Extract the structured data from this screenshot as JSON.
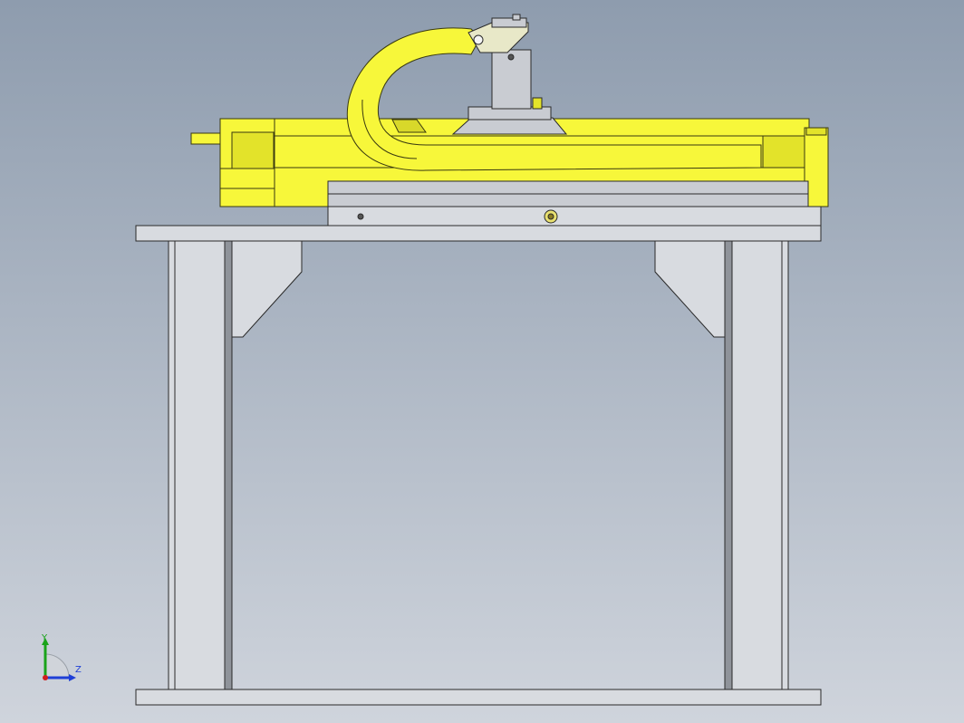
{
  "viewport": {
    "background_top": "#8e9cae",
    "background_bottom": "#cfd4dc"
  },
  "colors": {
    "frame_fill": "#d8dbe0",
    "frame_stroke": "#2a2a2a",
    "actuator_yellow": "#f7f73a",
    "actuator_shade": "#e3e32a",
    "carriage_grey": "#c9ccd2"
  },
  "triad": {
    "y_label": "Y",
    "z_label": "Z",
    "y_color": "#1aa31a",
    "z_color": "#1f3fd6",
    "x_color": "#d01e1e"
  }
}
